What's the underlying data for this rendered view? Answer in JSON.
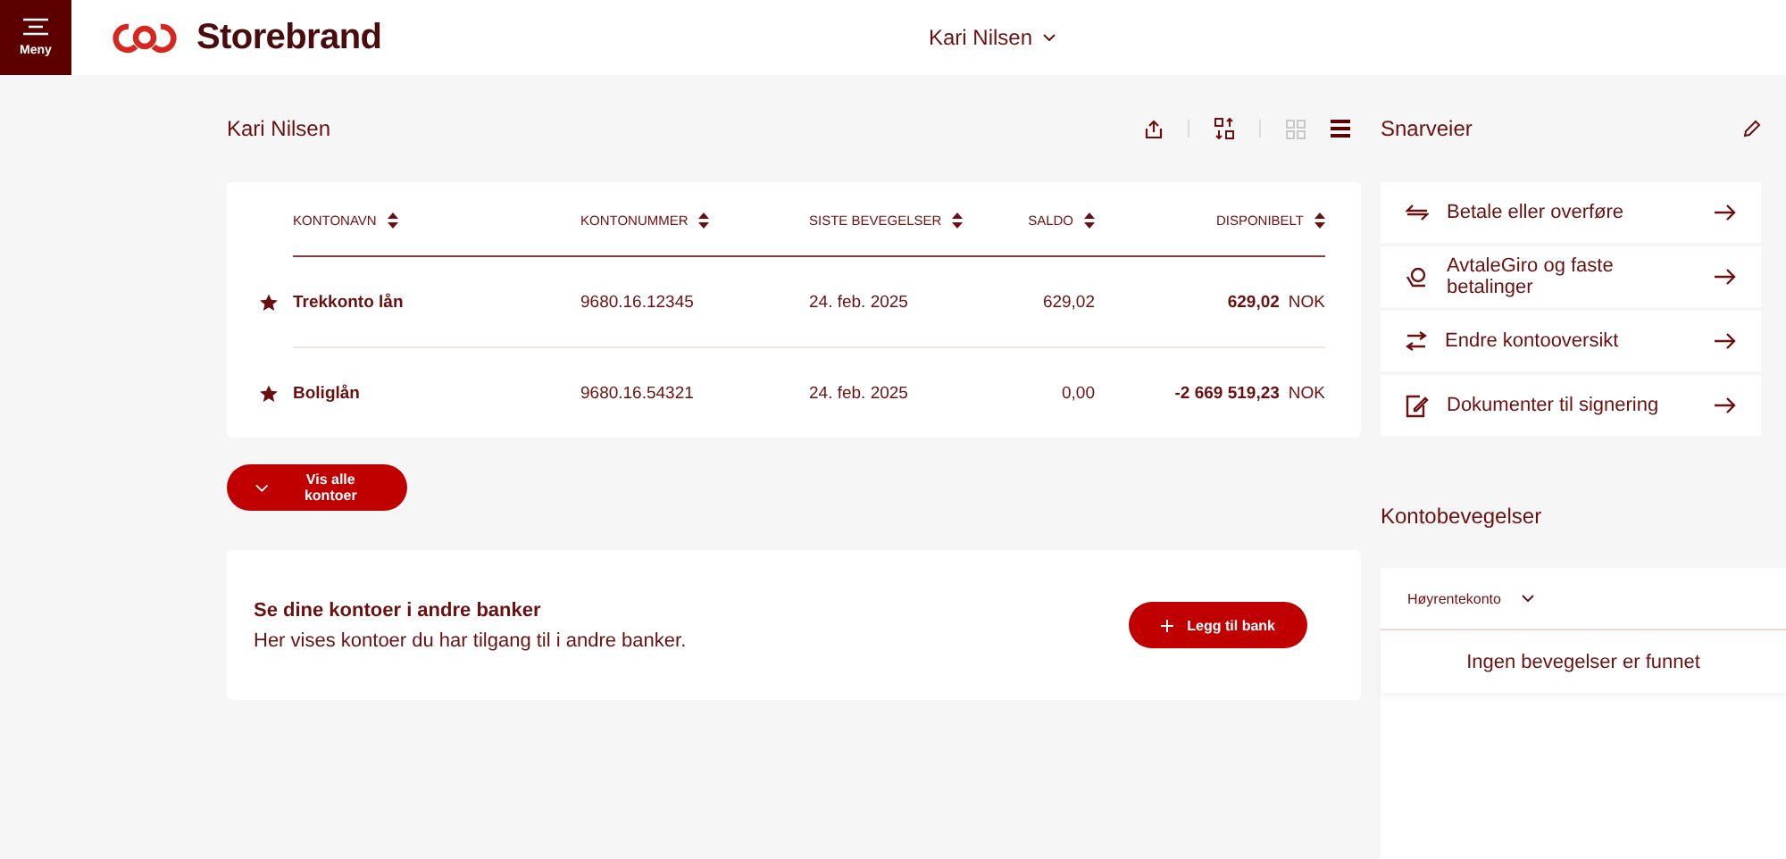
{
  "header": {
    "menu_label": "Meny",
    "logo_text": "Storebrand",
    "user": "Kari Nilsen"
  },
  "accounts": {
    "title": "Kari Nilsen",
    "view_options": [
      {
        "selected": false
      },
      {
        "selected": true
      }
    ],
    "columns": [
      "KONTONAVN",
      "KONTONUMMER",
      "SISTE BEVEGELSER",
      "SALDO",
      "DISPONIBELT"
    ],
    "rows": [
      {
        "favorite": true,
        "name": "Trekkonto lån",
        "number": "9680.16.12345",
        "last": "24. feb. 2025",
        "balance": "629,02",
        "available": "629,02",
        "currency": "NOK"
      },
      {
        "favorite": true,
        "name": "Boliglån",
        "number": "9680.16.54321",
        "last": "24. feb. 2025",
        "balance": "0,00",
        "available": "-2 669 519,23",
        "currency": "NOK"
      }
    ],
    "show_all_button": "Vis alle kontoer"
  },
  "other_banks": {
    "title": "Se dine kontoer i andre banker",
    "text": "Her vises kontoer du har tilgang til i andre banker.",
    "button": "Legg til bank"
  },
  "shortcuts": {
    "title": "Snarveier",
    "items": [
      "Betale eller overføre",
      "AvtaleGiro og faste betalinger",
      "Endre kontooversikt",
      "Dokumenter til signering"
    ]
  },
  "transactions": {
    "title": "Kontobevegelser",
    "account_select": "Høyrentekonto",
    "empty_message": "Ingen bevegelser er funnet"
  }
}
